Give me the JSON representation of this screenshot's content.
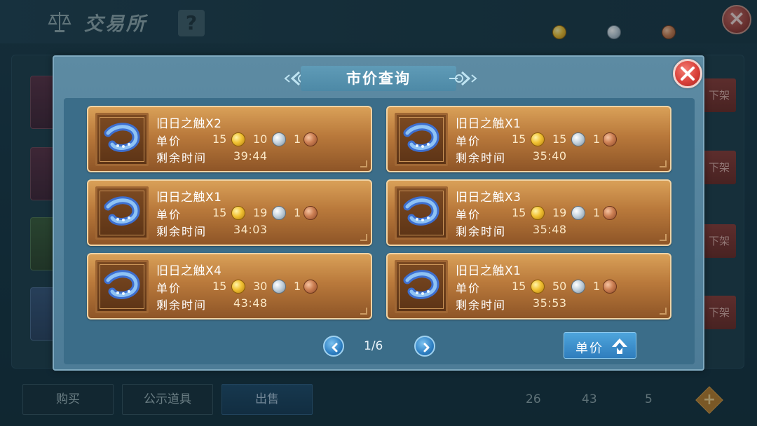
{
  "app": {
    "title": "交易所",
    "help_label": "?"
  },
  "side_buttons": [
    {
      "label": "下架"
    },
    {
      "label": "下架"
    },
    {
      "label": "下架"
    },
    {
      "label": "下架"
    }
  ],
  "bottom_tabs": [
    {
      "label": "购买",
      "active": false
    },
    {
      "label": "公示道具",
      "active": false
    },
    {
      "label": "出售",
      "active": true
    }
  ],
  "wallet": {
    "gold": "26",
    "silver": "43",
    "copper": "5"
  },
  "modal": {
    "title": "市价查询",
    "price_label": "单价",
    "time_label": "剩余时间",
    "listings": [
      {
        "name": "旧日之触X2",
        "gold": "15",
        "silver": "10",
        "copper": "1",
        "time": "39:44"
      },
      {
        "name": "旧日之触X1",
        "gold": "15",
        "silver": "15",
        "copper": "1",
        "time": "35:40"
      },
      {
        "name": "旧日之触X1",
        "gold": "15",
        "silver": "19",
        "copper": "1",
        "time": "34:03"
      },
      {
        "name": "旧日之触X3",
        "gold": "15",
        "silver": "19",
        "copper": "1",
        "time": "35:48"
      },
      {
        "name": "旧日之触X4",
        "gold": "15",
        "silver": "30",
        "copper": "1",
        "time": "43:48"
      },
      {
        "name": "旧日之触X1",
        "gold": "15",
        "silver": "50",
        "copper": "1",
        "time": "35:53"
      }
    ],
    "pager": {
      "text": "1/6"
    },
    "sort_button": {
      "label": "单价",
      "direction": "ascending"
    }
  },
  "colors": {
    "card": "#b9793b",
    "modal": "#5d8ba3",
    "close": "#d9403a",
    "accent_blue": "#2f7dbd"
  }
}
